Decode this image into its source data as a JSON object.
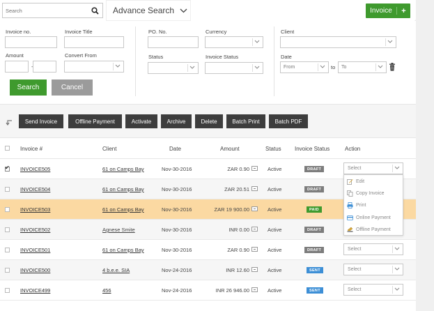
{
  "topbar": {
    "search_placeholder": "Search",
    "advance_search": "Advance Search",
    "invoice_button": "Invoice",
    "plus": "+"
  },
  "filters": {
    "invoice_no": "Invoice no.",
    "invoice_title": "Invoice Title",
    "amount": "Amount",
    "amount_sep": "-",
    "convert_from": "Convert From",
    "po_no": "PO. No.",
    "currency": "Currency",
    "status": "Status",
    "invoice_status": "Invoice Status",
    "client": "Client",
    "date": "Date",
    "date_from": "From",
    "date_to_sep": "to",
    "date_to": "To",
    "search_button": "Search",
    "cancel_button": "Cancel"
  },
  "toolbar": {
    "send_invoice": "Send Invoice",
    "offline_payment": "Offline Payment",
    "activate": "Activate",
    "archive": "Archive",
    "delete": "Delete",
    "batch_print": "Batch Print",
    "batch_pdf": "Batch PDF"
  },
  "table": {
    "headers": {
      "invoice": "Invoice #",
      "client": "Client",
      "date": "Date",
      "amount": "Amount",
      "status": "Status",
      "invoice_status": "Invoice Status",
      "action": "Action"
    },
    "rows": [
      {
        "checked": true,
        "invoice": "INVOICE505",
        "client": "61 on Camps Bay",
        "date": "Nov-30-2016",
        "amount": "ZAR 0.90",
        "status": "Active",
        "badge": "DRAFT",
        "action": "Select"
      },
      {
        "checked": false,
        "invoice": "INVOICE504",
        "client": "61 on Camps Bay",
        "date": "Nov-30-2016",
        "amount": "ZAR 20.51",
        "status": "Active",
        "badge": "DRAFT",
        "action": ""
      },
      {
        "checked": false,
        "invoice": "INVOICE503",
        "client": "61 on Camps Bay",
        "date": "Nov-30-2016",
        "amount": "ZAR 19 900.00",
        "status": "Active",
        "badge": "PAID",
        "action": ""
      },
      {
        "checked": false,
        "invoice": "INVOICE502",
        "client": "Agnese Smite",
        "date": "Nov-30-2016",
        "amount": "INR 0.00",
        "status": "Active",
        "badge": "DRAFT",
        "action": ""
      },
      {
        "checked": false,
        "invoice": "INVOICE501",
        "client": "61 on Camps Bay",
        "date": "Nov-30-2016",
        "amount": "ZAR 0.90",
        "status": "Active",
        "badge": "DRAFT",
        "action": "Select"
      },
      {
        "checked": false,
        "invoice": "INVOICE500",
        "client": "4 b.e.e. SIA",
        "date": "Nov-24-2016",
        "amount": "INR 12.60",
        "status": "Active",
        "badge": "SENT",
        "action": "Select"
      },
      {
        "checked": false,
        "invoice": "INVOICE499",
        "client": "456",
        "date": "Nov-24-2016",
        "amount": "INR 26 946.00",
        "status": "Active",
        "badge": "SENT",
        "action": "Select"
      }
    ]
  },
  "action_menu": {
    "edit": "Edit",
    "copy_invoice": "Copy Invoice",
    "print": "Print",
    "online_payment": "Online Payment",
    "offline_payment": "Offline Payment"
  },
  "colors": {
    "primary_green": "#3f9a2e",
    "cancel_gray": "#9b9b9b",
    "toolbar_dark": "#3d3d3d",
    "highlight_row": "#fbd9a2",
    "badge_draft": "#7d7d7d",
    "badge_paid": "#3f9a2e",
    "badge_sent": "#3d8fd6"
  }
}
